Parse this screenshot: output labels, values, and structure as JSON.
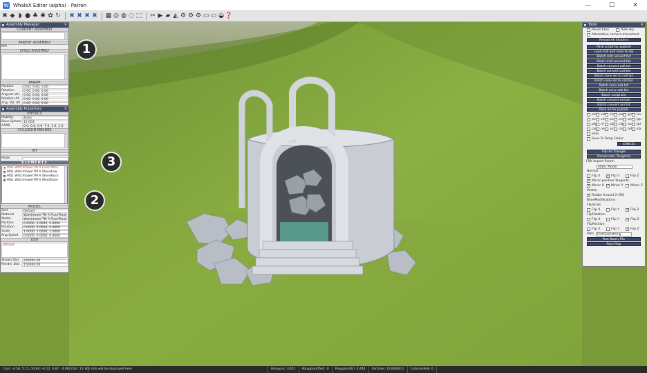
{
  "window": {
    "title": "WhaleX Editor (alpha) - Patron",
    "min": "—",
    "max": "☐",
    "close": "✕"
  },
  "toolbar": {
    "group1": [
      "✖",
      "◆",
      "◗",
      "●",
      "♣",
      "✱",
      "✿",
      "↻"
    ],
    "group2": [
      "✖",
      "✖",
      "✖",
      "✖"
    ],
    "group3": [
      "▦",
      "◎",
      "◍",
      "◌",
      "⬚"
    ],
    "group4": [
      "✂",
      "▶",
      "▰",
      "◭",
      "⚙",
      "⚙",
      "⚙",
      "▭",
      "▭",
      "◒",
      "❓"
    ]
  },
  "assembly": {
    "title": "Assembly Manager",
    "current": "CURRENT ASSEMBLY",
    "parent": "PARENT ASSEMBLY",
    "parent_value": "N/A",
    "child": "CHILD ASSEMBLY",
    "param": "PARAM",
    "params": [
      {
        "label": "Position",
        "value": "0.00, 0.00, 0.00"
      },
      {
        "label": "Rotation",
        "value": "0.00, 0.00, 0.00"
      },
      {
        "label": "Angular Vel.",
        "value": "0.00, 0.00, 0.00"
      },
      {
        "label": "Rotation AP",
        "value": "0.00, 0.00, 0.00"
      },
      {
        "label": "Ang. Vel. AP",
        "value": "0.00, 0.00, 0.00"
      }
    ]
  },
  "properties": {
    "title": "Assembly Properties",
    "physics": "PHYSICS",
    "mobility_label": "Mobility",
    "mobility_value": "Static",
    "bsphere_label": "Boun Sphere",
    "bsphere_value": "12.003",
    "aabb_label": "AABB",
    "aabb_value": "0.0, 0.0, 0.8  -7.0, 1.0, 1.0",
    "collision": "COLLISION MESHES",
    "hit": "HIT",
    "mode_label": "Mode",
    "elements": "ELEMENTS",
    "elements_items": [
      "MDL WatchtowerTM A FloorPlank",
      "MDL WatchtowerTM A StoneFew",
      "MDL WatchtowerTM A StoneRock",
      "MDL WatchtowerTM A WoodDark"
    ],
    "model": "MODEL",
    "model_rows": [
      {
        "label": "Sort",
        "value": "Default"
      },
      {
        "label": "Material",
        "value": "WatchtowerTM A FloorPlank"
      },
      {
        "label": "Model",
        "value": "WatchtowerTM A FloorPlank"
      },
      {
        "label": "Position",
        "value": "0.0000, 0.0000, 0.0000"
      },
      {
        "label": "Rotation",
        "value": "0.0000, 0.0000, 0.0000"
      },
      {
        "label": "Scale",
        "value": "1.0000, 1.0000, 1.0000"
      },
      {
        "label": "Ang Speed",
        "value": "0.0000, 0.0000, 0.0000"
      }
    ],
    "lod": "LOD",
    "lod_value": "Default",
    "shown_dist_label": "Shown Dist",
    "shown_dist_value": "200000.00",
    "render_dist_label": "Render Dist",
    "render_dist_value": "150000.00"
  },
  "tools": {
    "title": "Tools",
    "pause_time": "Pause time",
    "hide_sky": "Hide sky",
    "alt_camera": "Alternative camera movement",
    "buttons": [
      "Reload All Shaders",
      "Pack script for publish",
      "Load mdl and save to obj",
      "Batch mdl convert txt",
      "Batch mdl convert bin",
      "Batch convert coll txt",
      "Batch convert coll bin",
      "Batch conv skl to coll txt",
      "Batch conv skl to coll bin",
      "Batch conv asb txt",
      "Batch conv asb bin",
      "Batch script bin",
      "Batch convert ani bin",
      "Batch convert ani txt",
      "Pack all for publish"
    ],
    "exts": [
      "ede",
      "sal",
      "chp",
      "pwr",
      "gra",
      "lev",
      "ans",
      "cha",
      "ava",
      "eng",
      "ano",
      "ipp",
      "pfp",
      "nf",
      "sph",
      "clip",
      "anc",
      "tpl",
      "cvls",
      "nm",
      "sml",
      "cih",
      "tef",
      "sfx",
      "amb"
    ],
    "save_temp": "Save To Temp Folder",
    "cancel": "CANCEL",
    "flip_all": "Flip All Triangle",
    "recalc": "Recalculate Tangents",
    "fbx_label": "FBX Import Param",
    "fbx_value": "Static Model",
    "normal": "Normal",
    "flipx": "Flip X",
    "flipy": "Flip Y",
    "flipz": "Flip Z",
    "mirror_pos": "Mirror positive Tangents",
    "mirrorx": "Mirror X",
    "mirrory": "Mirror Y",
    "mirrorz": "Mirror Z",
    "vertex": "Vertex",
    "rotate_x": "Rotate Around X (90)",
    "bone_mod": "BoneModifications",
    "flip_scale": "FlipScale",
    "flip_rot": "FlipRotation",
    "flip_pos": "FlipPosition",
    "path_label": "Path",
    "path_value": "Fort/Something",
    "run_batch": "Run Batch File",
    "pack_map": "Pack Map"
  },
  "status": [
    "Cam: -4.58, 5.15, 10.84 (-0.12, 0.87, -0.08) (Dst: 11.90)",
    "Info will be displayed here",
    "Polygons: 3,611",
    "PolygonsEffect: 0",
    "PolygonsGUI: 4,444",
    "Particles: (0.000042)",
    "CollisionPoly: 0"
  ],
  "callouts": [
    "1",
    "2",
    "3"
  ]
}
